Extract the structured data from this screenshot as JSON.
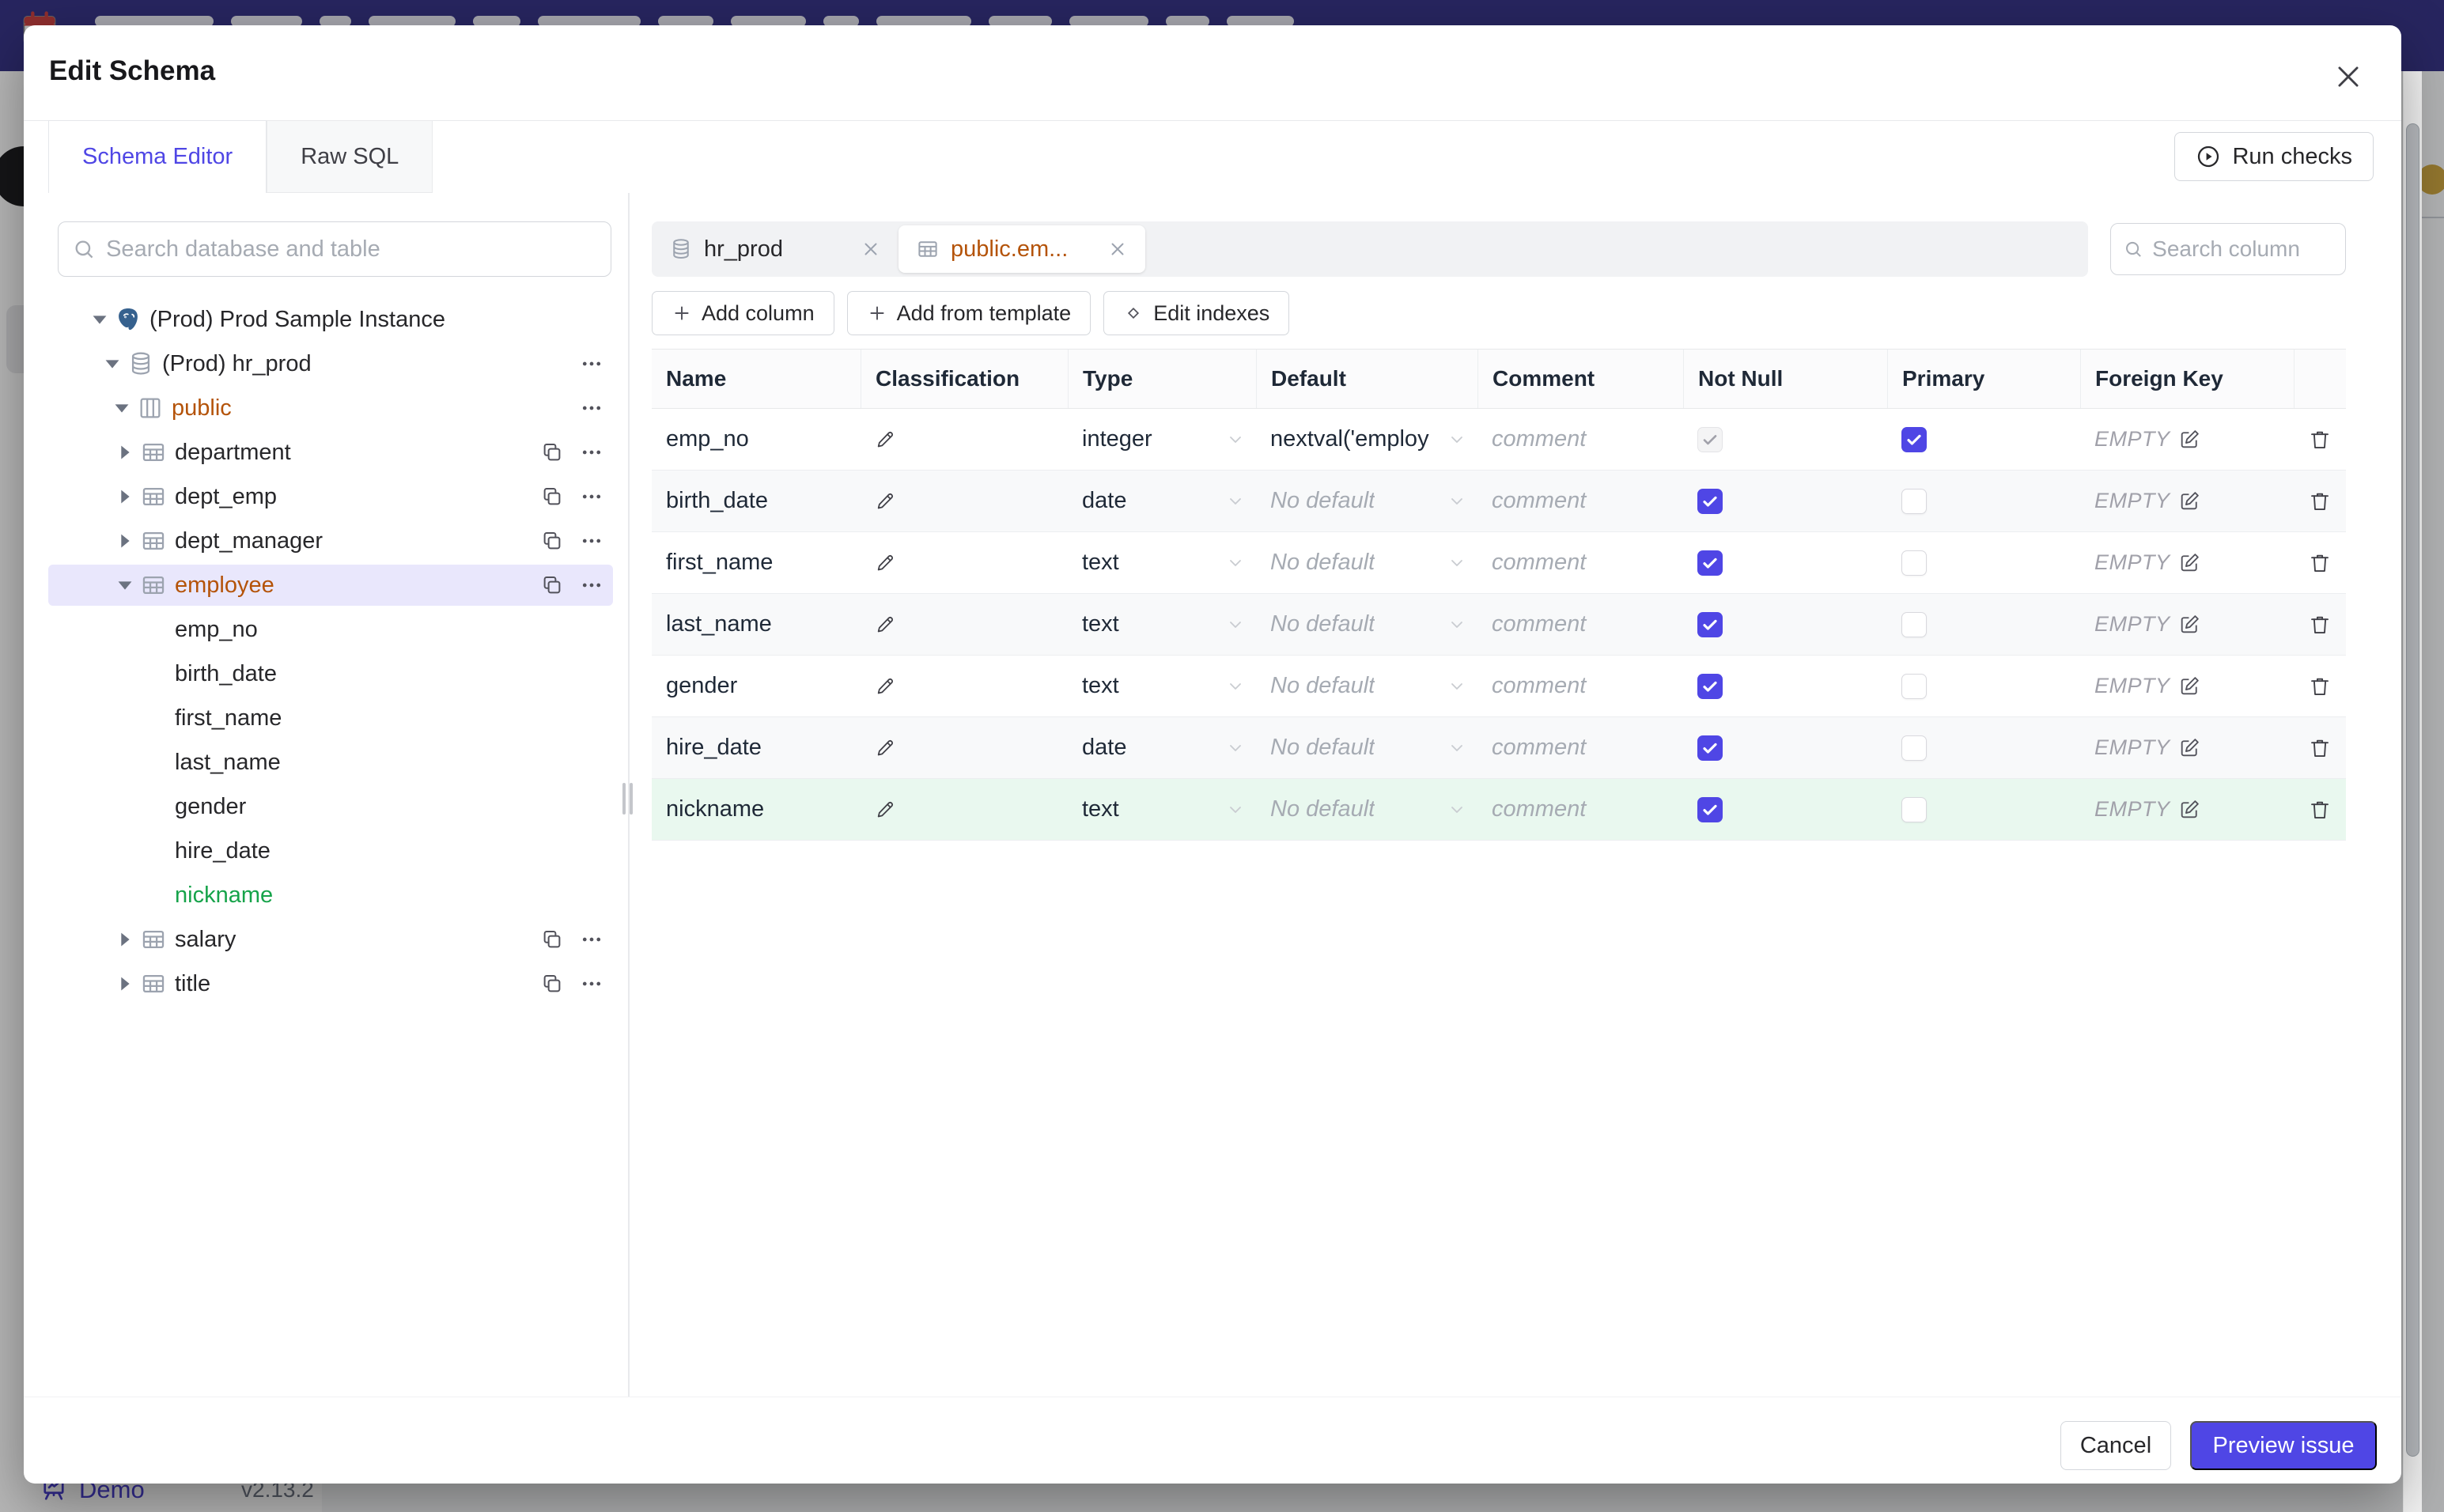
{
  "colors": {
    "accent": "#4f46e5",
    "banner": "#312e81",
    "amber": "#b45309",
    "green": "#16a34a",
    "row_highlight": "#e9f8ef",
    "tree_selection": "#e9e7fc"
  },
  "app_footer": {
    "demo_label": "Demo",
    "version": "v2.13.2"
  },
  "modal": {
    "title": "Edit Schema",
    "tabs": [
      {
        "label": "Schema Editor",
        "active": true
      },
      {
        "label": "Raw SQL",
        "active": false
      }
    ],
    "run_checks": {
      "label": "Run checks",
      "icon": "play-circle"
    },
    "sidebar": {
      "search_placeholder": "Search database and table",
      "tree": [
        {
          "label": "(Prod) Prod Sample Instance",
          "icon": "postgres",
          "caret": "down",
          "indent": 50
        },
        {
          "label": "(Prod) hr_prod",
          "icon": "database",
          "caret": "down",
          "indent": 66,
          "menu": true
        },
        {
          "label": "public",
          "icon": "schema",
          "caret": "down",
          "indent": 78,
          "color": "amber",
          "menu": true
        },
        {
          "label": "department",
          "icon": "table",
          "caret": "right",
          "indent": 82,
          "copy": true,
          "menu": true
        },
        {
          "label": "dept_emp",
          "icon": "table",
          "caret": "right",
          "indent": 82,
          "copy": true,
          "menu": true
        },
        {
          "label": "dept_manager",
          "icon": "table",
          "caret": "right",
          "indent": 82,
          "copy": true,
          "menu": true
        },
        {
          "label": "employee",
          "icon": "table",
          "caret": "down",
          "indent": 82,
          "color": "amber",
          "selected": true,
          "copy": true,
          "menu": true
        },
        {
          "label": "emp_no",
          "indent": 160,
          "column": true
        },
        {
          "label": "birth_date",
          "indent": 160,
          "column": true
        },
        {
          "label": "first_name",
          "indent": 160,
          "column": true
        },
        {
          "label": "last_name",
          "indent": 160,
          "column": true
        },
        {
          "label": "gender",
          "indent": 160,
          "column": true
        },
        {
          "label": "hire_date",
          "indent": 160,
          "column": true
        },
        {
          "label": "nickname",
          "indent": 160,
          "column": true,
          "color": "green"
        },
        {
          "label": "salary",
          "icon": "table",
          "caret": "right",
          "indent": 82,
          "copy": true,
          "menu": true
        },
        {
          "label": "title",
          "icon": "table",
          "caret": "right",
          "indent": 82,
          "copy": true,
          "menu": true
        }
      ]
    },
    "editor": {
      "open_tabs": [
        {
          "label": "hr_prod",
          "icon": "database",
          "active": false
        },
        {
          "label": "public.em...",
          "icon": "table",
          "active": true
        }
      ],
      "column_search_placeholder": "Search column",
      "toolbar": [
        {
          "label": "Add column",
          "icon": "plus"
        },
        {
          "label": "Add from template",
          "icon": "plus"
        },
        {
          "label": "Edit indexes",
          "icon": "diamond"
        }
      ],
      "table": {
        "headers": [
          "Name",
          "Classification",
          "Type",
          "Default",
          "Comment",
          "Not Null",
          "Primary",
          "Foreign Key",
          ""
        ],
        "comment_placeholder": "comment",
        "no_default_placeholder": "No default",
        "fk_empty_label": "EMPTY",
        "rows": [
          {
            "name": "emp_no",
            "type": "integer",
            "default": "nextval('employ",
            "has_default": true,
            "not_null_checked": true,
            "not_null_disabled": true,
            "primary": true,
            "highlight": false
          },
          {
            "name": "birth_date",
            "type": "date",
            "default": "",
            "has_default": false,
            "not_null_checked": true,
            "not_null_disabled": false,
            "primary": false,
            "highlight": false
          },
          {
            "name": "first_name",
            "type": "text",
            "default": "",
            "has_default": false,
            "not_null_checked": true,
            "not_null_disabled": false,
            "primary": false,
            "highlight": false
          },
          {
            "name": "last_name",
            "type": "text",
            "default": "",
            "has_default": false,
            "not_null_checked": true,
            "not_null_disabled": false,
            "primary": false,
            "highlight": false
          },
          {
            "name": "gender",
            "type": "text",
            "default": "",
            "has_default": false,
            "not_null_checked": true,
            "not_null_disabled": false,
            "primary": false,
            "highlight": false
          },
          {
            "name": "hire_date",
            "type": "date",
            "default": "",
            "has_default": false,
            "not_null_checked": true,
            "not_null_disabled": false,
            "primary": false,
            "highlight": false
          },
          {
            "name": "nickname",
            "type": "text",
            "default": "",
            "has_default": false,
            "not_null_checked": true,
            "not_null_disabled": false,
            "primary": false,
            "highlight": true
          }
        ]
      }
    },
    "footer": {
      "cancel_label": "Cancel",
      "primary_label": "Preview issue"
    }
  },
  "icons": {
    "search-icon": "⌕",
    "close-icon": "✕",
    "play-circle-icon": "▶",
    "plus-icon": "+",
    "diamond-icon": "◇",
    "pencil-icon": "✎",
    "chevron-down-icon": "⌄",
    "edit-icon": "✎",
    "trash-icon": "🗑",
    "copy-icon": "⧉",
    "ellipsis-icon": "⋯",
    "caret-down-icon": "▾",
    "caret-right-icon": "▸",
    "database-icon": "⛁",
    "table-icon": "▦",
    "schema-icon": "▥",
    "postgres-icon": "🐘",
    "presentation-icon": "📊",
    "calendar-icon": "📅"
  }
}
